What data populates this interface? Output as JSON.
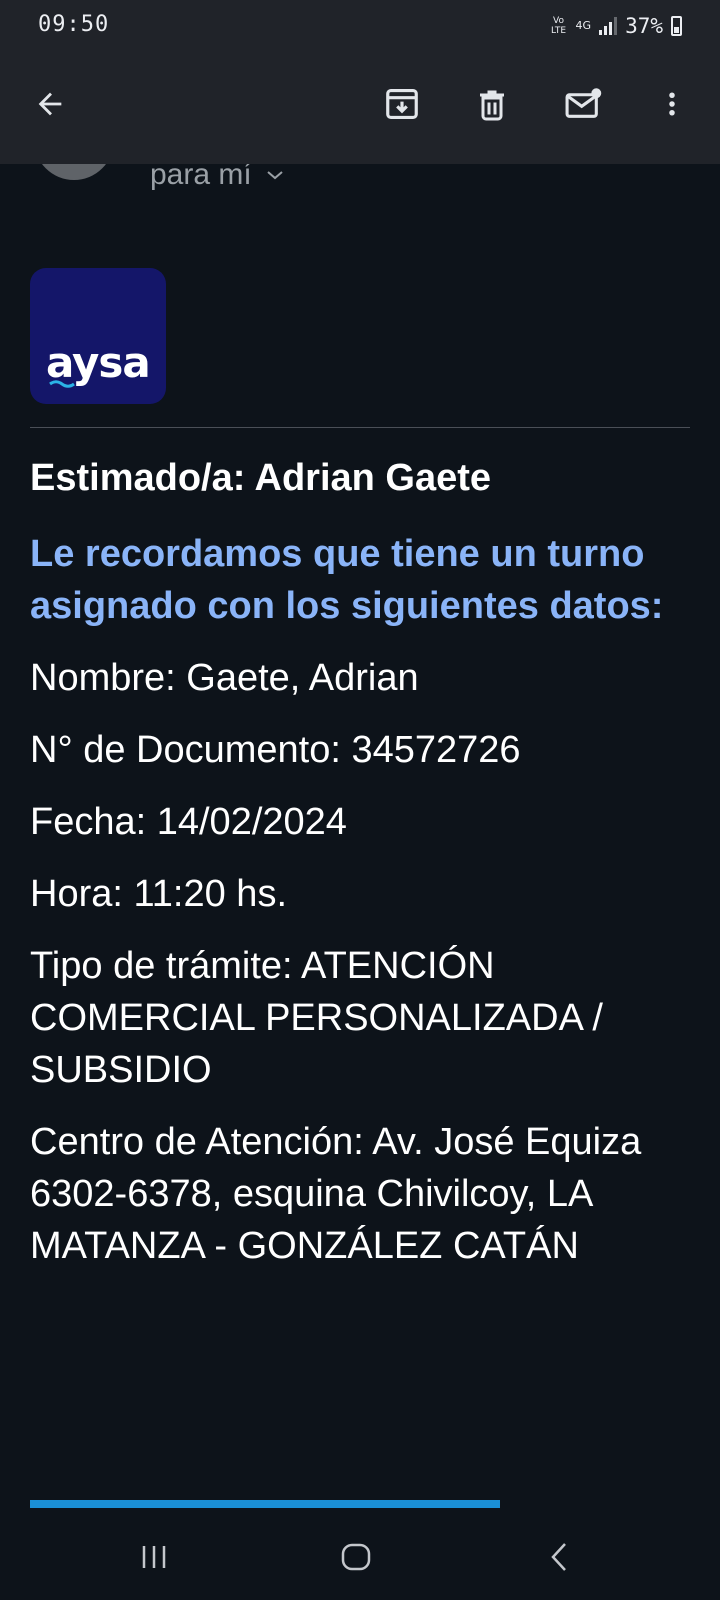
{
  "status": {
    "time": "09:50",
    "network_top": "Vo LTE",
    "network_type": "4G",
    "battery": "37%"
  },
  "toolbar": {
    "back_icon": "arrow-left-icon",
    "archive_icon": "archive-icon",
    "delete_icon": "trash-icon",
    "mark_unread_icon": "mail-unread-icon",
    "more_icon": "more-vert-icon"
  },
  "email": {
    "recipient": "para mí",
    "logo_text": "aysa",
    "greeting": "Estimado/a: Adrian Gaete",
    "intro": "Le recordamos que tiene un turno asignado con los siguientes datos:",
    "fields": [
      "Nombre: Gaete, Adrian",
      "N° de Documento: 34572726",
      "Fecha: 14/02/2024",
      "Hora: 11:20 hs.",
      "Tipo de trámite: ATENCIÓN COMERCIAL PERSONALIZADA / SUBSIDIO",
      "Centro de Atención: Av. José Equiza 6302-6378, esquina Chivilcoy, LA MATANZA - GONZÁLEZ CATÁN"
    ]
  },
  "colors": {
    "background": "#0d131a",
    "toolbar": "#202329",
    "link_blue": "#8ab4f8",
    "logo_bg": "#141669",
    "progress": "#1a8fd6"
  },
  "navbar": {
    "recents_icon": "recents-icon",
    "home_icon": "home-icon",
    "back_icon": "back-chevron-icon"
  }
}
